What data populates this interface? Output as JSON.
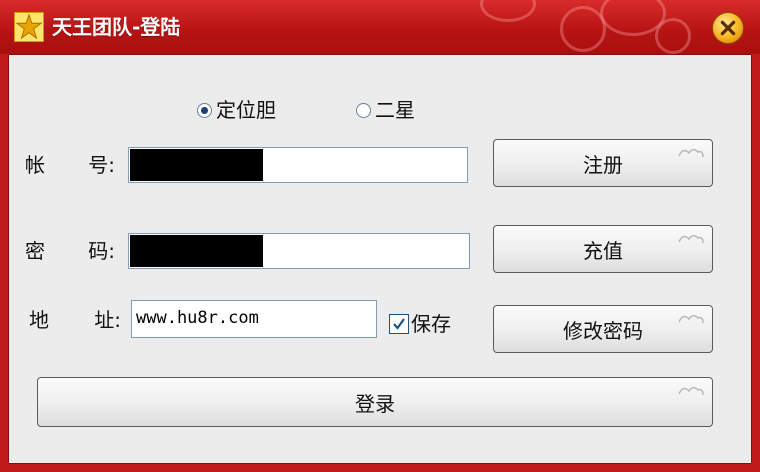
{
  "window": {
    "title": "天王团队-登陆"
  },
  "login_type": {
    "options": [
      {
        "label": "定位胆",
        "checked": true
      },
      {
        "label": "二星",
        "checked": false
      }
    ]
  },
  "account": {
    "label_a": "帐",
    "label_b": "号",
    "colon": ":",
    "value": ""
  },
  "password": {
    "label_a": "密",
    "label_b": "码",
    "colon": ":",
    "value": ""
  },
  "address": {
    "label_a": "地",
    "label_b": "址",
    "colon": ":",
    "value": "www.hu8r.com"
  },
  "save": {
    "label": "保存",
    "checked": true
  },
  "buttons": {
    "register": "注册",
    "recharge": "充值",
    "change_password": "修改密码",
    "login": "登录"
  }
}
